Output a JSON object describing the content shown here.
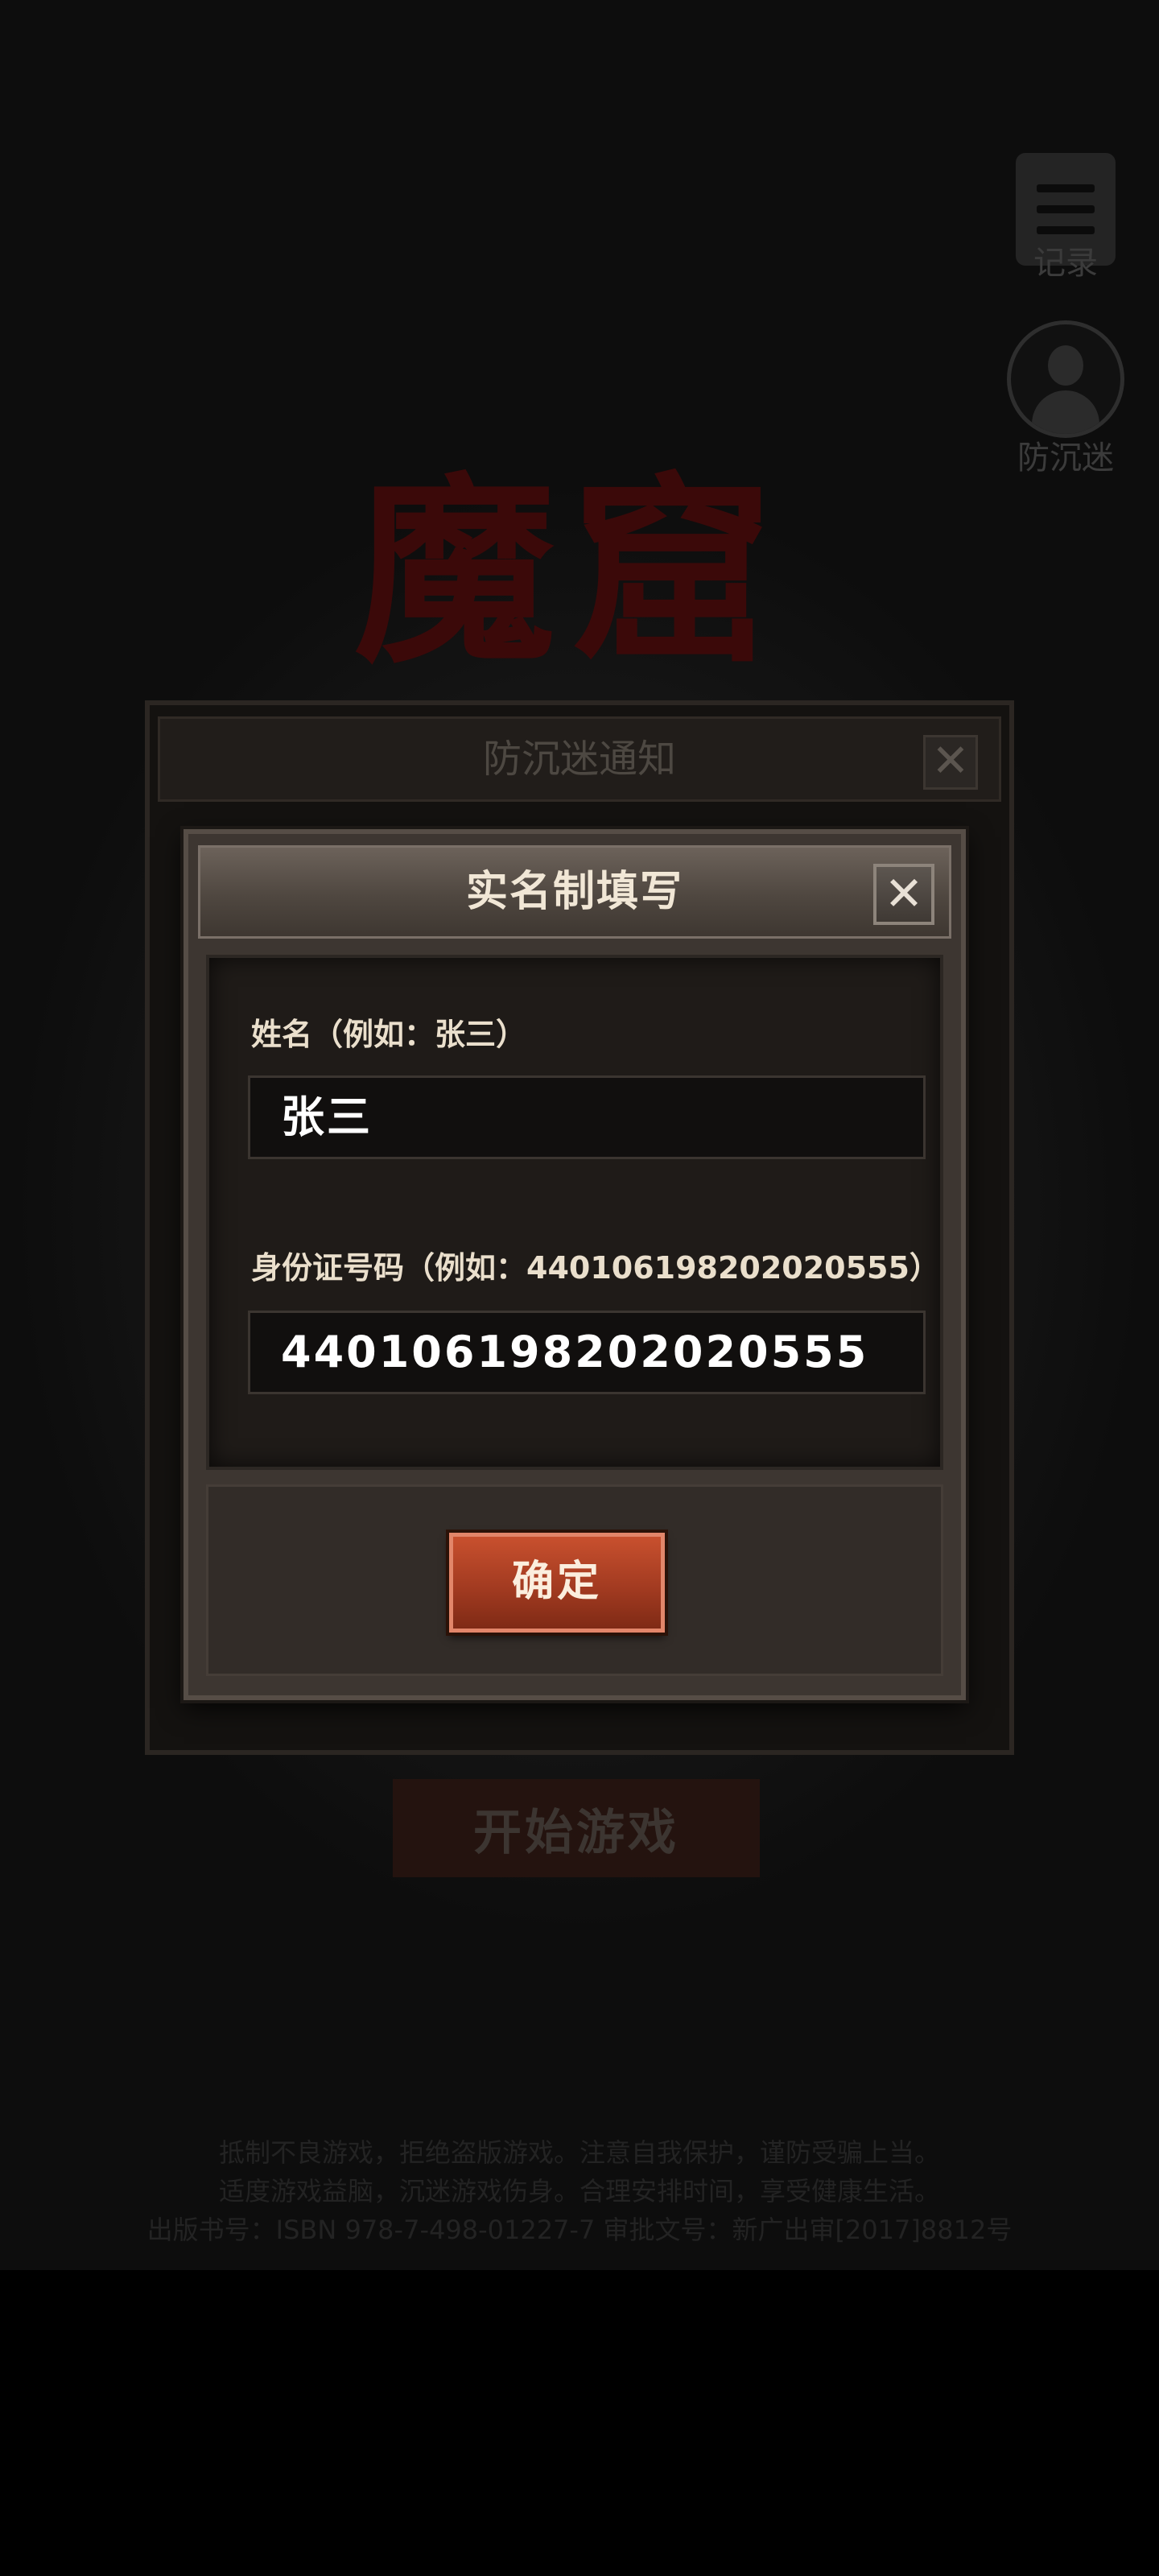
{
  "background": {
    "records_label": "记录",
    "anti_addiction_label": "防沉迷",
    "logo_text": "魔窟",
    "start_game_label": "开始游戏",
    "legal_lines": [
      "抵制不良游戏，拒绝盗版游戏。注意自我保护，谨防受骗上当。",
      "适度游戏益脑，沉迷游戏伤身。合理安排时间，享受健康生活。",
      "出版书号：ISBN 978-7-498-01227-7  审批文号：新广出审[2017]8812号"
    ]
  },
  "notice_dialog": {
    "title": "防沉迷通知",
    "close_icon": "close-icon"
  },
  "realname_dialog": {
    "title": "实名制填写",
    "close_icon": "close-icon",
    "name_field": {
      "label": "姓名（例如：张三）",
      "value": "张三"
    },
    "id_field": {
      "label": "身份证号码（例如：440106198202020555）",
      "value": "440106198202020555"
    },
    "confirm_label": "确定"
  },
  "colors": {
    "confirm_button": "#a33b21",
    "dialog_frame": "#564d46",
    "input_bg": "#110f0e"
  }
}
